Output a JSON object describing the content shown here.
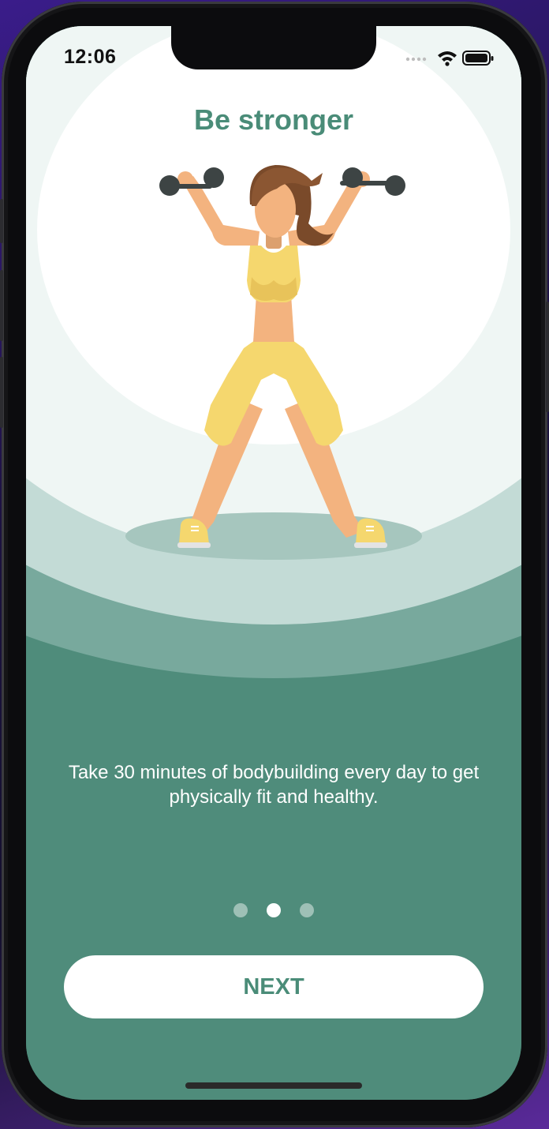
{
  "status_bar": {
    "time": "12:06",
    "icons": [
      "signal-dots-icon",
      "wifi-icon",
      "battery-icon"
    ]
  },
  "onboarding": {
    "title": "Be stronger",
    "description": "Take 30 minutes of bodybuilding every day to get physically fit and healthy.",
    "illustration": "woman-lifting-dumbbells-illustration",
    "pagination": {
      "total": 3,
      "active_index": 1
    },
    "next_label": "NEXT"
  },
  "colors": {
    "accent": "#4a8c78",
    "background_dark": "#4f8c7b",
    "background_mid": "#78a99d",
    "background_light": "#c3dbd6",
    "background_pale": "#eff6f4",
    "card": "#ffffff"
  }
}
